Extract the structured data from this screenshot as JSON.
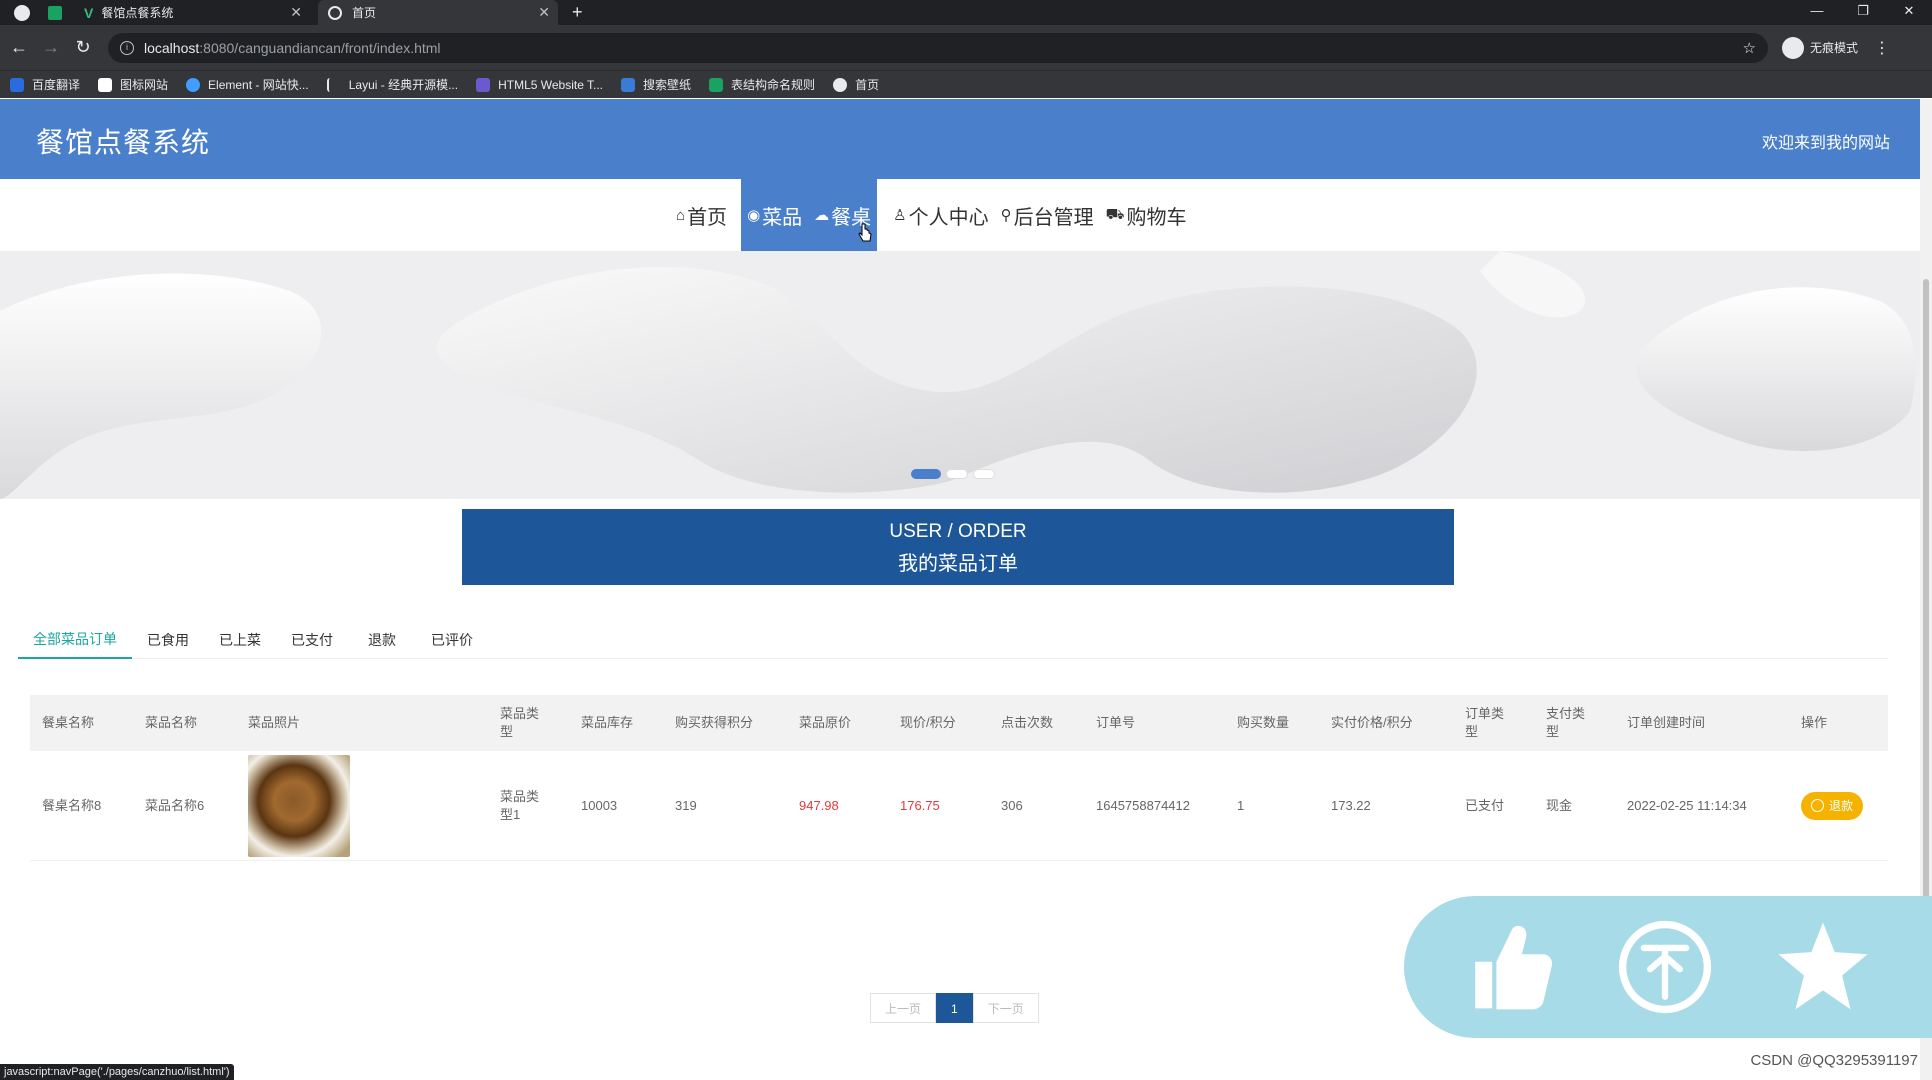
{
  "browser": {
    "tabs": [
      {
        "title": "餐馆点餐系统"
      },
      {
        "title": "首页"
      }
    ],
    "url_host": "localhost",
    "url_path": ":8080/canguandiancan/front/index.html",
    "incognito_label": "无痕模式",
    "bookmarks": [
      {
        "label": "百度翻译",
        "color": "#2a6be0"
      },
      {
        "label": "图标网站",
        "color": "#ffffff"
      },
      {
        "label": "Element - 网站快...",
        "color": "#409eff"
      },
      {
        "label": "Layui - 经典开源模...",
        "color": "#35363a"
      },
      {
        "label": "HTML5 Website T...",
        "color": "#6a5acd"
      },
      {
        "label": "搜索壁纸",
        "color": "#3a7bd5"
      },
      {
        "label": "表结构命名规则",
        "color": "#1aa260"
      },
      {
        "label": "首页",
        "color": "#e8eaed"
      }
    ],
    "status_url": "javascript:navPage('./pages/canzhuo/list.html')"
  },
  "header": {
    "title": "餐馆点餐系统",
    "welcome": "欢迎来到我的网站"
  },
  "nav": {
    "items": [
      {
        "label": "首页",
        "icon": "home-icon",
        "glyph": "⌂"
      },
      {
        "label": "菜品",
        "icon": "dish-icon",
        "glyph": "◉"
      },
      {
        "label": "餐桌",
        "icon": "table-icon",
        "glyph": "☁"
      },
      {
        "label": "个人中心",
        "icon": "user-icon",
        "glyph": "♙"
      },
      {
        "label": "后台管理",
        "icon": "link-icon",
        "glyph": "⚲"
      },
      {
        "label": "购物车",
        "icon": "cart-icon",
        "glyph": "⛟"
      }
    ],
    "active_index": 1
  },
  "banner": {
    "slide_count": 3,
    "active_slide": 0
  },
  "order_header": {
    "en": "USER / ORDER",
    "cn": "我的菜品订单"
  },
  "subtabs": [
    "全部菜品订单",
    "已食用",
    "已上菜",
    "已支付",
    "退款",
    "已评价"
  ],
  "table": {
    "headers": [
      "餐桌名称",
      "菜品名称",
      "菜品照片",
      "菜品类型",
      "菜品库存",
      "购买获得积分",
      "菜品原价",
      "现价/积分",
      "点击次数",
      "订单号",
      "购买数量",
      "实付价格/积分",
      "订单类型",
      "支付类型",
      "订单创建时间",
      "操作"
    ],
    "rows": [
      {
        "table_name": "餐桌名称8",
        "dish_name": "菜品名称6",
        "dish_type": "菜品类型1",
        "stock": "10003",
        "points": "319",
        "original_price": "947.98",
        "current_price": "176.75",
        "clicks": "306",
        "order_no": "1645758874412",
        "quantity": "1",
        "paid": "173.22",
        "order_type": "已支付",
        "pay_type": "现金",
        "created": "2022-02-25 11:14:34",
        "action": "退款"
      }
    ]
  },
  "pager": {
    "prev": "上一页",
    "current": "1",
    "next": "下一页"
  },
  "watermark": "CSDN @QQ3295391197",
  "colors": {
    "primary": "#4a7fcb",
    "order_bar": "#1e5799",
    "tab_active": "#19a79f",
    "refund": "#f5b300",
    "price": "#e4393c",
    "float_panel": "#a8dbe8"
  }
}
